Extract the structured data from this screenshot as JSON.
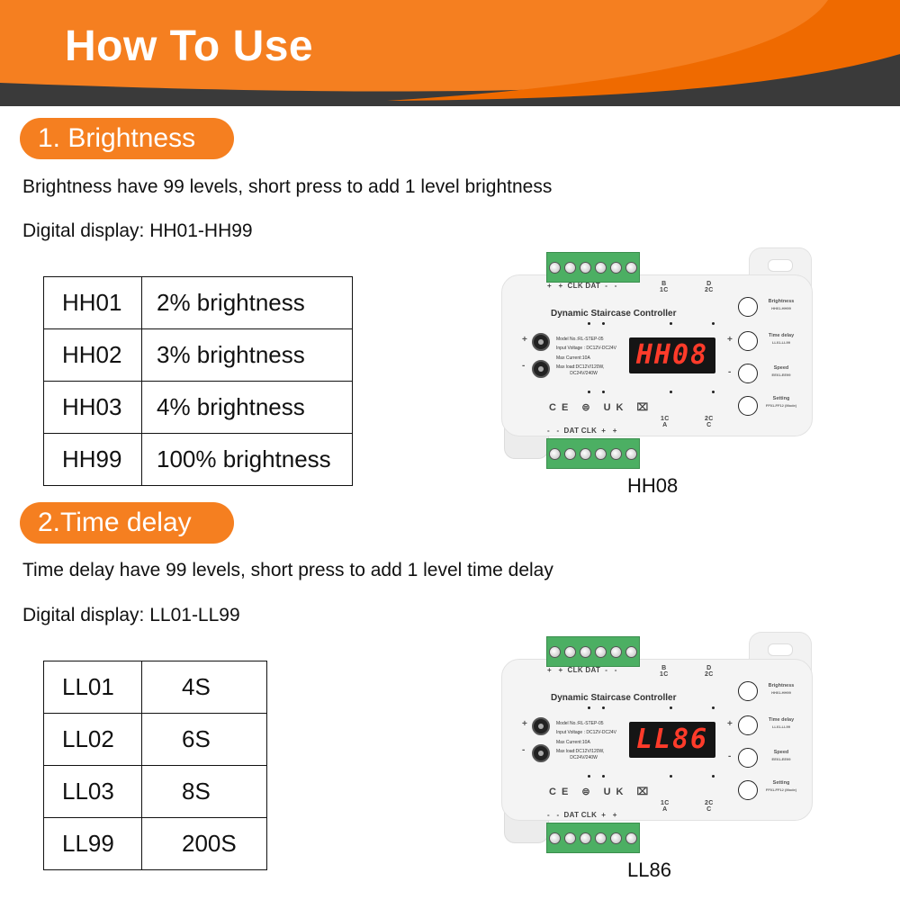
{
  "header": {
    "title": "How To Use",
    "colors": {
      "orange": "#f57f20",
      "dark_orange": "#ef6a00",
      "dark": "#3a3a3a"
    }
  },
  "sections": [
    {
      "pill": "1. Brightness",
      "description": "Brightness have 99 levels, short press to add 1 level brightness",
      "display_range": "Digital display: HH01-HH99",
      "table": [
        {
          "code": "HH01",
          "value": "2% brightness"
        },
        {
          "code": "HH02",
          "value": "3% brightness"
        },
        {
          "code": "HH03",
          "value": "4% brightness"
        },
        {
          "code": "HH99",
          "value": "100% brightness"
        }
      ],
      "device": {
        "display": "HH08",
        "caption": "HH08"
      }
    },
    {
      "pill": "2.Time delay",
      "description": "Time delay have 99 levels, short press to add 1 level time delay",
      "display_range": "Digital display: LL01-LL99",
      "table": [
        {
          "code": "LL01",
          "value": "4S"
        },
        {
          "code": "LL02",
          "value": "6S"
        },
        {
          "code": "LL03",
          "value": "8S"
        },
        {
          "code": "LL99",
          "value": "200S"
        }
      ],
      "device": {
        "display": "LL86",
        "caption": "LL86"
      }
    }
  ],
  "device_common": {
    "name": "Dynamic Staircase Controller",
    "specs": [
      "Model No.:RL-STEP-05",
      "Input Voltage : DC12V-DC24V",
      "Max Current:10A",
      "Max load:DC12V/120W,",
      "           DC24V/240W"
    ],
    "top_pins": "+   +  CLK DAT  -   -",
    "bottom_pins": "-   -  DAT CLK  +   +",
    "top_right_labels": [
      "B\n1C",
      "D\n2C"
    ],
    "bottom_right_labels": [
      "1C\nA",
      "2C\nC"
    ],
    "plus": "+",
    "minus": "-",
    "certifications": "CE ⊜ UK ⌧",
    "buttons": [
      {
        "label": "Brightness",
        "sub": "HH01-HH99"
      },
      {
        "label": "Time delay",
        "sub": "LL01-LL99"
      },
      {
        "label": "Speed",
        "sub": "EE01-EE99"
      },
      {
        "label": "Setting",
        "sub": "FF01-FF12 (Mode)"
      }
    ]
  }
}
